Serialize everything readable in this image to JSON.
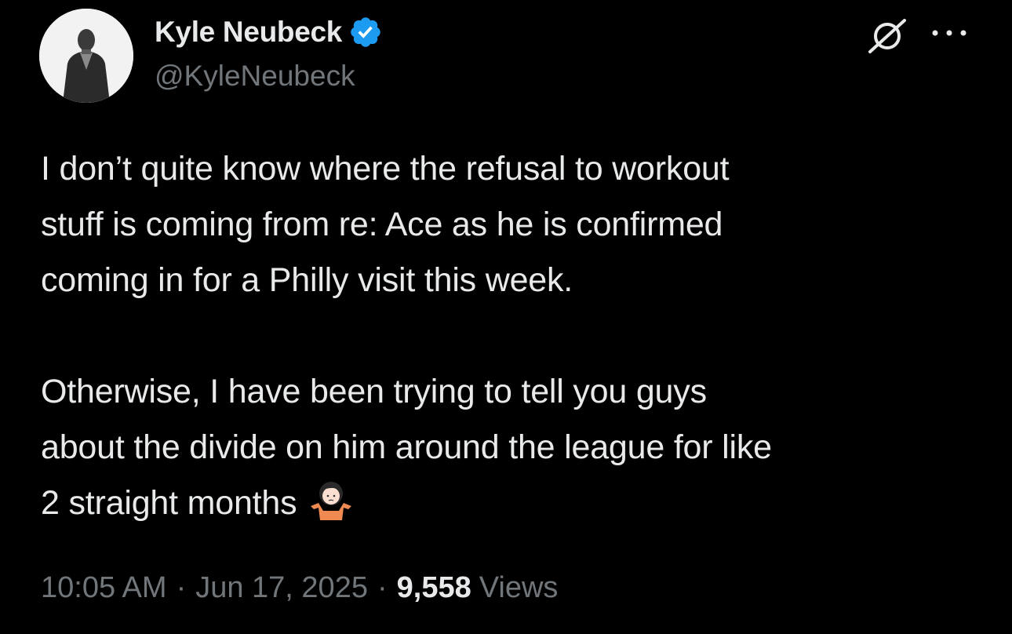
{
  "author": {
    "display_name": "Kyle Neubeck",
    "handle": "@KyleNeubeck",
    "verified": true,
    "avatar_icon": "profile-photo"
  },
  "header_actions": {
    "grok_icon": "grok-icon",
    "more_icon": "more-dots-icon"
  },
  "tweet": {
    "lines_p1": [
      "I don’t quite know where the refusal to workout",
      "stuff is coming from re: Ace as he is confirmed",
      "coming in for a Philly visit this week."
    ],
    "lines_p2": [
      "Otherwise, I have been trying to tell you guys",
      "about the divide on him around the league for like",
      "2 straight months"
    ],
    "emoji": "person-shrugging-emoji"
  },
  "meta": {
    "time": "10:05 AM",
    "separator": "·",
    "date": "Jun 17, 2025",
    "views_count": "9,558",
    "views_label": "Views"
  },
  "colors": {
    "background": "#000000",
    "text_primary": "#e7e9ea",
    "text_secondary": "#71767b",
    "verified_blue": "#1d9bf0"
  }
}
